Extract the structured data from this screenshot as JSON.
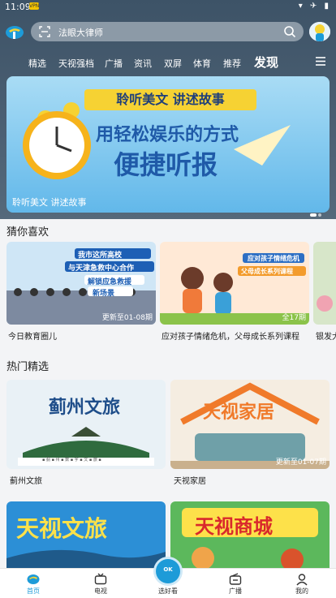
{
  "status_bar": {
    "time": "11:09",
    "badge": "VPN",
    "icons": "▾ ✈ ▮"
  },
  "search": {
    "placeholder": "法眼大律师"
  },
  "nav": {
    "items": [
      "精选",
      "天视强档",
      "广播",
      "资讯",
      "双屏",
      "体育",
      "推荐",
      "发现"
    ],
    "active": "发现"
  },
  "banner": {
    "ribbon": "聆听美文 讲述故事",
    "headline_1": "用轻松娱乐的方式",
    "headline_2": "便捷听报",
    "caption": "聆听美文 讲述故事"
  },
  "guess_section": {
    "title": "猜你喜欢",
    "cards": [
      {
        "title": "今日教育圈儿",
        "update": "更新至01-08期",
        "poster_lines": [
          "我市这所高校",
          "与天津急救中心合作",
          "解锁应急救援",
          "新场景"
        ]
      },
      {
        "title": "应对孩子情绪危机，父母成长系列课程",
        "update": "全17期",
        "poster_lines": [
          "应对孩子情绪危机",
          "父母成长系列课程"
        ]
      },
      {
        "title": "银发大",
        "update": "",
        "poster_lines": []
      }
    ]
  },
  "hot_section": {
    "title": "热门精选",
    "cards": [
      {
        "title": "蓟州文旅",
        "update": "",
        "poster_text": "蓟州文旅",
        "poster_sub": "▪ 蓟 ▪ 州 ▪ 数 ▪ 字 ▪ 文 ▪ 旅 ▪"
      },
      {
        "title": "天视家居",
        "update": "更新至01-07期",
        "poster_text": "天视家居"
      },
      {
        "title": "",
        "update": "",
        "poster_text": "天视文旅"
      },
      {
        "title": "",
        "update": "",
        "poster_text": "天视商城"
      }
    ]
  },
  "tabbar": {
    "items": [
      "首页",
      "电视",
      "选好看",
      "广播",
      "我的"
    ],
    "ok_label": "OK",
    "active": "首页"
  },
  "colors": {
    "accent": "#1d9bd8",
    "header_bg": "#465a6d",
    "ribbon_yellow": "#f6d233",
    "headline_blue": "#1f5aa8"
  }
}
